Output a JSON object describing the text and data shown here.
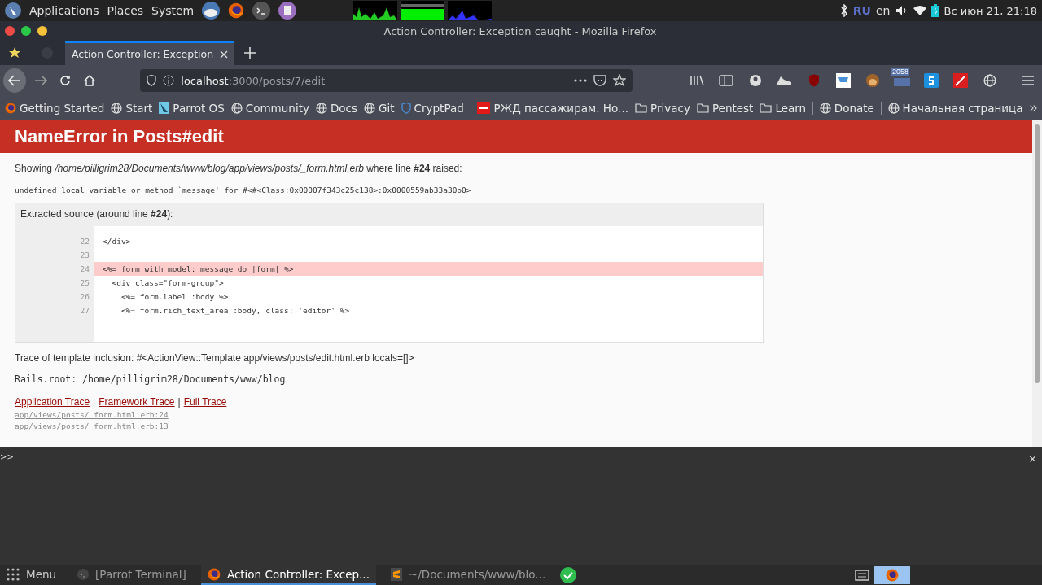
{
  "top_panel": {
    "menus": [
      "Applications",
      "Places",
      "System"
    ],
    "keyboard": "RU",
    "language": "en",
    "clock": "Вс июн 21, 21:18"
  },
  "window": {
    "title": "Action Controller: Exception caught - Mozilla Firefox"
  },
  "tabs": [
    {
      "label": "Action Controller: Exception",
      "selected": true
    }
  ],
  "url_bar": {
    "host": "localhost",
    "path": ":3000/posts/7/edit"
  },
  "toolbar": {
    "badge": "2058"
  },
  "bookmarks": [
    {
      "kind": "firefox",
      "label": "Getting Started"
    },
    {
      "kind": "globe",
      "label": "Start"
    },
    {
      "kind": "parrot",
      "label": "Parrot OS"
    },
    {
      "kind": "globe",
      "label": "Community"
    },
    {
      "kind": "globe",
      "label": "Docs"
    },
    {
      "kind": "globe",
      "label": "Git"
    },
    {
      "kind": "shield",
      "label": "CryptPad"
    },
    {
      "kind": "separator"
    },
    {
      "kind": "rzd",
      "label": "РЖД пассажирам. Но..."
    },
    {
      "kind": "folder",
      "label": "Privacy"
    },
    {
      "kind": "folder",
      "label": "Pentest"
    },
    {
      "kind": "folder",
      "label": "Learn"
    },
    {
      "kind": "separator"
    },
    {
      "kind": "globe",
      "label": "Donate"
    },
    {
      "kind": "separator"
    },
    {
      "kind": "globe",
      "label": "Начальная страница"
    }
  ],
  "page": {
    "heading": "NameError in Posts#edit",
    "showing": "Showing */home/pilligrim28/Documents/www/blog/app/views/posts/_form.html.erb* where line **#24** raised:",
    "message": "undefined local variable or method `message' for #<#<Class:0x00007f343c25c138>:0x0000559ab33a30b0>",
    "source_title": "Extracted source (around line **#24**):",
    "source_lines": [
      {
        "number": "22",
        "code": "</div>",
        "highlighted": false
      },
      {
        "number": "23",
        "highlighted": false
      },
      {
        "number": "24",
        "code": "<%= form_with model: message do |form| %>",
        "highlighted": true
      },
      {
        "number": "25",
        "code": "  <div class=\"form-group\">",
        "highlighted": false
      },
      {
        "number": "26",
        "code": "    <%= form.label :body %>",
        "highlighted": false
      },
      {
        "number": "27",
        "code": "    <%= form.rich_text_area :body, class: 'editor' %>",
        "highlighted": false
      }
    ],
    "template_trace": "Trace of template inclusion: #<ActionView::Template app/views/posts/edit.html.erb locals=[]>",
    "rails_root": "Rails.root: /home/pilligrim28/Documents/www/blog",
    "trace_links": [
      "Application Trace",
      "Framework Trace",
      "Full Trace"
    ],
    "trace_link_separator": "|",
    "trace_lines": [
      "app/views/posts/_form.html.erb:24",
      "app/views/posts/_form.html.erb:13"
    ]
  },
  "console": {
    "prompt": ">>",
    "close": "×"
  },
  "taskbar": {
    "menu": "Menu",
    "tasks": [
      {
        "kind": "terminal",
        "label": "[Parrot Terminal]",
        "active": false
      },
      {
        "kind": "firefox",
        "label": "Action Controller: Excep...",
        "active": true
      },
      {
        "kind": "sublime",
        "label": "~/Documents/www/blo...",
        "active": false
      }
    ]
  }
}
